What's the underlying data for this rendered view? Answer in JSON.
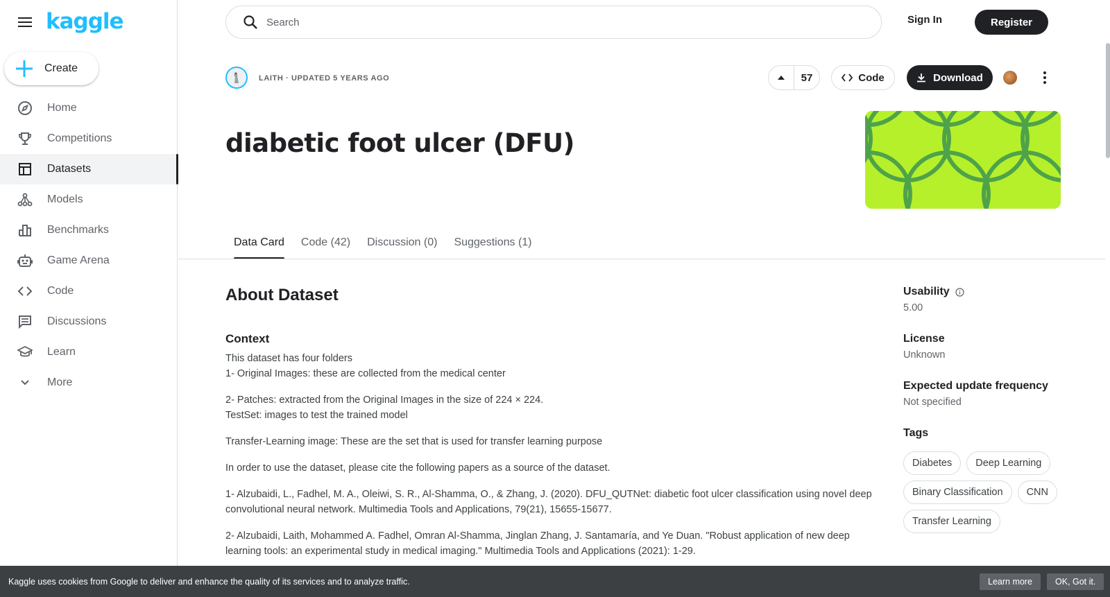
{
  "brand": {
    "logo_text": "kaggle",
    "accent": "#20beff"
  },
  "sidebar": {
    "create_label": "Create",
    "items": [
      {
        "label": "Home",
        "icon": "compass-icon"
      },
      {
        "label": "Competitions",
        "icon": "trophy-icon"
      },
      {
        "label": "Datasets",
        "icon": "table-icon",
        "active": true
      },
      {
        "label": "Models",
        "icon": "models-icon"
      },
      {
        "label": "Benchmarks",
        "icon": "bar-chart-icon"
      },
      {
        "label": "Game Arena",
        "icon": "robot-icon"
      },
      {
        "label": "Code",
        "icon": "code-icon"
      },
      {
        "label": "Discussions",
        "icon": "chat-icon"
      },
      {
        "label": "Learn",
        "icon": "school-icon"
      },
      {
        "label": "More",
        "icon": "chevron-down-icon"
      }
    ]
  },
  "header": {
    "search_placeholder": "Search",
    "sign_in": "Sign In",
    "register": "Register"
  },
  "dataset": {
    "meta": "LAITH · UPDATED 5 YEARS AGO",
    "votes": "57",
    "code_label": "Code",
    "download_label": "Download",
    "title": "diabetic foot ulcer (DFU)",
    "cover_color": "#b6f02a"
  },
  "tabs": [
    {
      "label": "Data Card",
      "active": true
    },
    {
      "label": "Code (42)"
    },
    {
      "label": "Discussion (0)"
    },
    {
      "label": "Suggestions (1)"
    }
  ],
  "content": {
    "about_heading": "About Dataset",
    "context_heading": "Context",
    "paragraphs": [
      [
        "This dataset has four folders",
        "1- Original Images: these are collected from the medical center"
      ],
      [
        "2- Patches: extracted from the Original Images in the size of 224 × 224.",
        "TestSet: images to test the trained model"
      ],
      [
        "Transfer-Learning image: These are the set that is used for transfer learning purpose"
      ],
      [
        "In order to use the dataset, please cite the following papers as a source of the dataset."
      ],
      [
        "1- Alzubaidi, L., Fadhel, M. A., Oleiwi, S. R., Al-Shamma, O., & Zhang, J. (2020). DFU_QUTNet: diabetic foot ulcer classification using novel deep convolutional neural network. Multimedia Tools and Applications, 79(21), 15655-15677."
      ],
      [
        "2- Alzubaidi, Laith, Mohammed A. Fadhel, Omran Al-Shamma, Jinglan Zhang, J. Santamaría, and Ye Duan. \"Robust application of new deep learning tools: an experimental study in medical imaging.\" Multimedia Tools and Applications (2021): 1-29."
      ]
    ]
  },
  "info": {
    "usability_label": "Usability",
    "usability_value": "5.00",
    "license_label": "License",
    "license_value": "Unknown",
    "frequency_label": "Expected update frequency",
    "frequency_value": "Not specified",
    "tags_label": "Tags",
    "tags": [
      "Diabetes",
      "Deep Learning",
      "Binary Classification",
      "CNN",
      "Transfer Learning"
    ]
  },
  "cookie": {
    "message": "Kaggle uses cookies from Google to deliver and enhance the quality of its services and to analyze traffic.",
    "learn_more": "Learn more",
    "ok": "OK, Got it."
  }
}
